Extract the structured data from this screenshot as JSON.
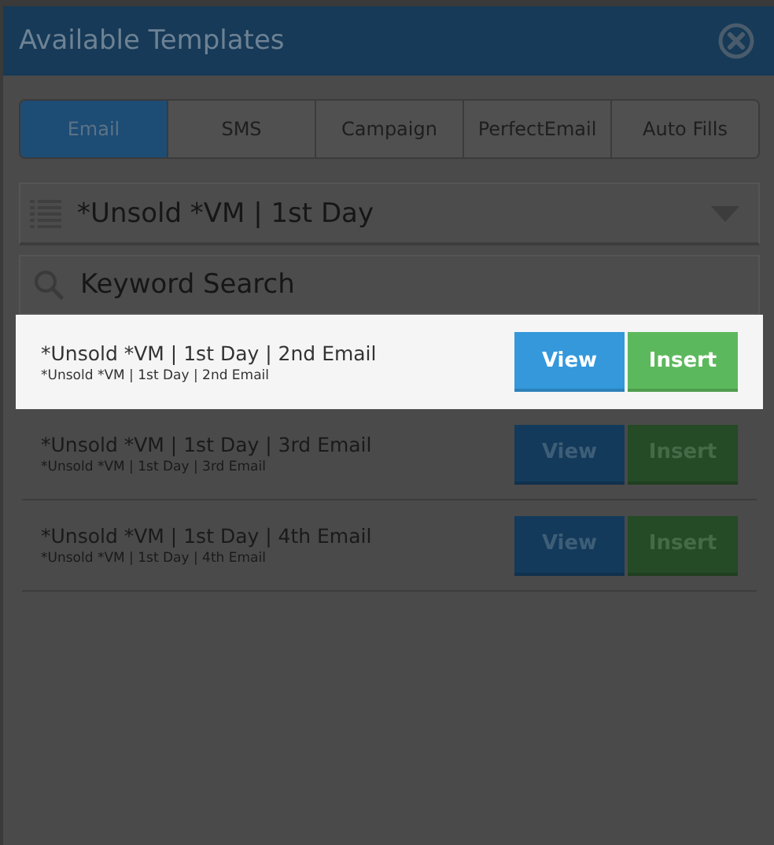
{
  "window": {
    "title": "Available Templates"
  },
  "tabs": [
    {
      "label": "Email",
      "selected": true
    },
    {
      "label": "SMS",
      "selected": false
    },
    {
      "label": "Campaign",
      "selected": false
    },
    {
      "label": "PerfectEmail",
      "selected": false
    },
    {
      "label": "Auto Fills",
      "selected": false
    }
  ],
  "category_dropdown": {
    "value": "*Unsold *VM | 1st Day"
  },
  "search": {
    "placeholder": "Keyword Search"
  },
  "templates": [
    {
      "title": "*Unsold *VM | 1st Day | 2nd Email",
      "subtitle": "*Unsold *VM | 1st Day | 2nd Email",
      "highlighted": true,
      "view_label": "View",
      "insert_label": "Insert"
    },
    {
      "title": "*Unsold *VM | 1st Day | 3rd Email",
      "subtitle": "*Unsold *VM | 1st Day | 3rd Email",
      "highlighted": false,
      "view_label": "View",
      "insert_label": "Insert"
    },
    {
      "title": "*Unsold *VM | 1st Day | 4th Email",
      "subtitle": "*Unsold *VM | 1st Day | 4th Email",
      "highlighted": false,
      "view_label": "View",
      "insert_label": "Insert"
    }
  ]
}
